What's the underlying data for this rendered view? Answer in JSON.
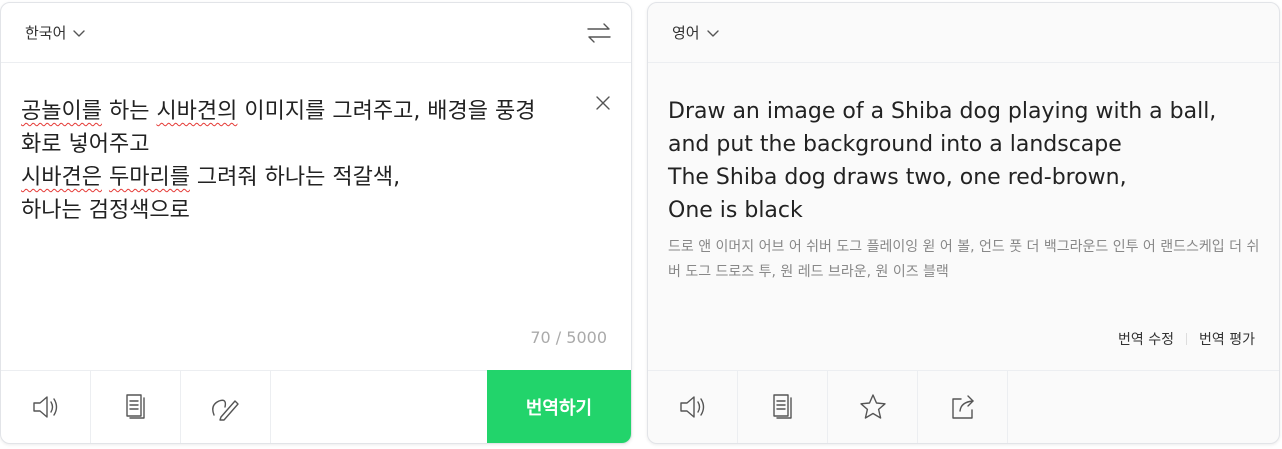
{
  "source": {
    "language": "한국어",
    "text_lines": [
      {
        "segments": [
          {
            "t": "공놀이를",
            "spell": true
          },
          {
            "t": " 하는 ",
            "spell": false
          },
          {
            "t": "시바견의",
            "spell": true
          },
          {
            "t": " 이미지를 그려주고, 배경을 풍경",
            "spell": false
          }
        ]
      },
      {
        "segments": [
          {
            "t": "화로 넣어주고",
            "spell": false
          }
        ]
      },
      {
        "segments": [
          {
            "t": "시바견은",
            "spell": true
          },
          {
            "t": " ",
            "spell": false
          },
          {
            "t": "두마리를",
            "spell": true
          },
          {
            "t": " 그려줘 하나는 적갈색,",
            "spell": false
          }
        ]
      },
      {
        "segments": [
          {
            "t": "하나는 검정색으로",
            "spell": false
          }
        ]
      }
    ],
    "char_count": "70 / 5000",
    "translate_label": "번역하기",
    "tools": [
      "speaker-icon",
      "dictionary-icon",
      "handwriting-icon"
    ]
  },
  "target": {
    "language": "영어",
    "text": "Draw an image of a Shiba dog playing with a ball,\nand put the background into a landscape\nThe Shiba dog draws two, one red-brown,\nOne is black",
    "pronunciation": "드로 앤 이머지 어브 어 쉬버 도그 플레이잉 윋 어 볼, 언드 풋 더 백그라운드 인투 어 랜드스케입 더 쉬버 도그 드로즈 투, 원 레드 브라운, 원 이즈 블랙",
    "edit_label": "번역 수정",
    "rate_label": "번역 평가",
    "tools": [
      "speaker-icon",
      "copy-icon",
      "star-icon",
      "share-icon"
    ]
  },
  "colors": {
    "accent_green": "#22d46b",
    "spellcheck_red": "#e53935"
  }
}
